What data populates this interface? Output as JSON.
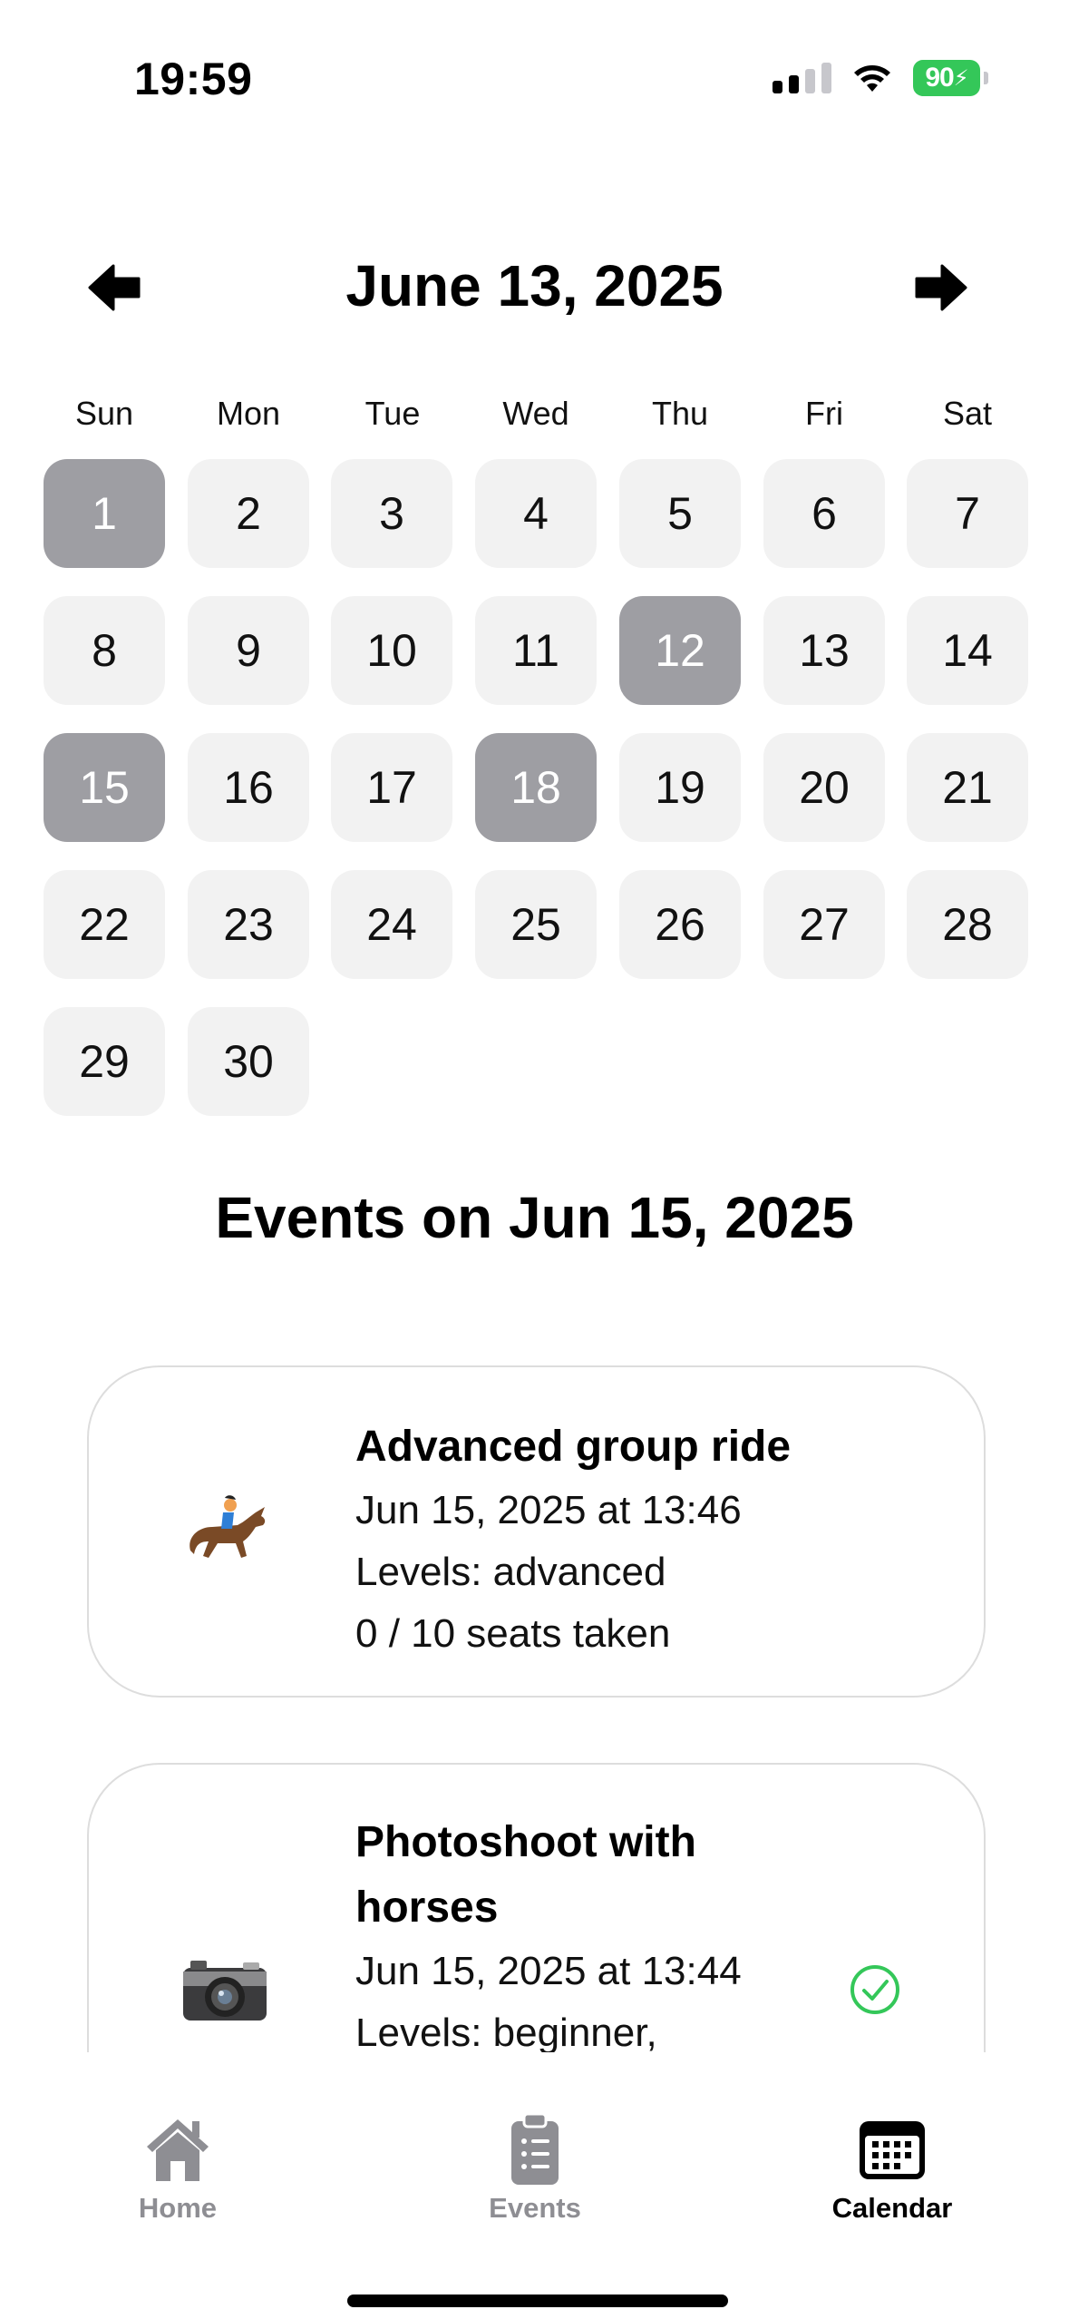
{
  "status_bar": {
    "time": "19:59",
    "battery": "90"
  },
  "header": {
    "title": "June 13, 2025",
    "prev_icon": "arrow-left-icon",
    "next_icon": "arrow-right-icon"
  },
  "weekdays": [
    "Sun",
    "Mon",
    "Tue",
    "Wed",
    "Thu",
    "Fri",
    "Sat"
  ],
  "days": [
    {
      "label": "1",
      "marked": true
    },
    {
      "label": "2"
    },
    {
      "label": "3"
    },
    {
      "label": "4"
    },
    {
      "label": "5"
    },
    {
      "label": "6"
    },
    {
      "label": "7"
    },
    {
      "label": "8"
    },
    {
      "label": "9"
    },
    {
      "label": "10"
    },
    {
      "label": "11"
    },
    {
      "label": "12",
      "marked": true
    },
    {
      "label": "13"
    },
    {
      "label": "14"
    },
    {
      "label": "15",
      "marked": true
    },
    {
      "label": "16"
    },
    {
      "label": "17"
    },
    {
      "label": "18",
      "marked": true
    },
    {
      "label": "19"
    },
    {
      "label": "20"
    },
    {
      "label": "21"
    },
    {
      "label": "22"
    },
    {
      "label": "23"
    },
    {
      "label": "24"
    },
    {
      "label": "25"
    },
    {
      "label": "26"
    },
    {
      "label": "27"
    },
    {
      "label": "28"
    },
    {
      "label": "29"
    },
    {
      "label": "30"
    }
  ],
  "events_title": "Events on Jun 15, 2025",
  "events": [
    {
      "icon": "horse-racing-icon",
      "title": "Advanced group ride",
      "datetime": "Jun 15, 2025 at 13:46",
      "levels": "Levels: advanced",
      "seats": "0 / 10 seats taken"
    },
    {
      "icon": "camera-icon",
      "title": "Photoshoot with horses",
      "datetime": "Jun 15, 2025 at 13:44",
      "levels": "Levels: beginner,",
      "status_icon": "check-circle-icon"
    }
  ],
  "tabs": [
    {
      "label": "Home",
      "icon": "house-icon",
      "active": false
    },
    {
      "label": "Events",
      "icon": "clipboard-list-icon",
      "active": false
    },
    {
      "label": "Calendar",
      "icon": "calendar-icon",
      "active": true
    }
  ],
  "colors": {
    "day_bg": "#f2f2f2",
    "day_marked_bg": "#9e9ea3",
    "battery": "#34c759",
    "check": "#34c759",
    "tab_inactive": "#8e8e93"
  }
}
